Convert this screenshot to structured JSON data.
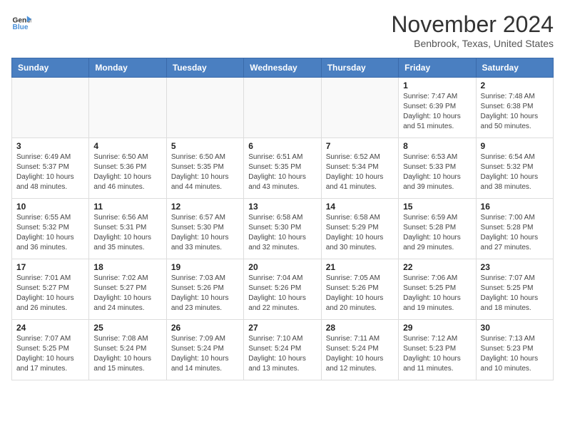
{
  "header": {
    "logo_line1": "General",
    "logo_line2": "Blue",
    "month": "November 2024",
    "location": "Benbrook, Texas, United States"
  },
  "days_of_week": [
    "Sunday",
    "Monday",
    "Tuesday",
    "Wednesday",
    "Thursday",
    "Friday",
    "Saturday"
  ],
  "weeks": [
    [
      {
        "day": "",
        "info": ""
      },
      {
        "day": "",
        "info": ""
      },
      {
        "day": "",
        "info": ""
      },
      {
        "day": "",
        "info": ""
      },
      {
        "day": "",
        "info": ""
      },
      {
        "day": "1",
        "info": "Sunrise: 7:47 AM\nSunset: 6:39 PM\nDaylight: 10 hours and 51 minutes."
      },
      {
        "day": "2",
        "info": "Sunrise: 7:48 AM\nSunset: 6:38 PM\nDaylight: 10 hours and 50 minutes."
      }
    ],
    [
      {
        "day": "3",
        "info": "Sunrise: 6:49 AM\nSunset: 5:37 PM\nDaylight: 10 hours and 48 minutes."
      },
      {
        "day": "4",
        "info": "Sunrise: 6:50 AM\nSunset: 5:36 PM\nDaylight: 10 hours and 46 minutes."
      },
      {
        "day": "5",
        "info": "Sunrise: 6:50 AM\nSunset: 5:35 PM\nDaylight: 10 hours and 44 minutes."
      },
      {
        "day": "6",
        "info": "Sunrise: 6:51 AM\nSunset: 5:35 PM\nDaylight: 10 hours and 43 minutes."
      },
      {
        "day": "7",
        "info": "Sunrise: 6:52 AM\nSunset: 5:34 PM\nDaylight: 10 hours and 41 minutes."
      },
      {
        "day": "8",
        "info": "Sunrise: 6:53 AM\nSunset: 5:33 PM\nDaylight: 10 hours and 39 minutes."
      },
      {
        "day": "9",
        "info": "Sunrise: 6:54 AM\nSunset: 5:32 PM\nDaylight: 10 hours and 38 minutes."
      }
    ],
    [
      {
        "day": "10",
        "info": "Sunrise: 6:55 AM\nSunset: 5:32 PM\nDaylight: 10 hours and 36 minutes."
      },
      {
        "day": "11",
        "info": "Sunrise: 6:56 AM\nSunset: 5:31 PM\nDaylight: 10 hours and 35 minutes."
      },
      {
        "day": "12",
        "info": "Sunrise: 6:57 AM\nSunset: 5:30 PM\nDaylight: 10 hours and 33 minutes."
      },
      {
        "day": "13",
        "info": "Sunrise: 6:58 AM\nSunset: 5:30 PM\nDaylight: 10 hours and 32 minutes."
      },
      {
        "day": "14",
        "info": "Sunrise: 6:58 AM\nSunset: 5:29 PM\nDaylight: 10 hours and 30 minutes."
      },
      {
        "day": "15",
        "info": "Sunrise: 6:59 AM\nSunset: 5:28 PM\nDaylight: 10 hours and 29 minutes."
      },
      {
        "day": "16",
        "info": "Sunrise: 7:00 AM\nSunset: 5:28 PM\nDaylight: 10 hours and 27 minutes."
      }
    ],
    [
      {
        "day": "17",
        "info": "Sunrise: 7:01 AM\nSunset: 5:27 PM\nDaylight: 10 hours and 26 minutes."
      },
      {
        "day": "18",
        "info": "Sunrise: 7:02 AM\nSunset: 5:27 PM\nDaylight: 10 hours and 24 minutes."
      },
      {
        "day": "19",
        "info": "Sunrise: 7:03 AM\nSunset: 5:26 PM\nDaylight: 10 hours and 23 minutes."
      },
      {
        "day": "20",
        "info": "Sunrise: 7:04 AM\nSunset: 5:26 PM\nDaylight: 10 hours and 22 minutes."
      },
      {
        "day": "21",
        "info": "Sunrise: 7:05 AM\nSunset: 5:26 PM\nDaylight: 10 hours and 20 minutes."
      },
      {
        "day": "22",
        "info": "Sunrise: 7:06 AM\nSunset: 5:25 PM\nDaylight: 10 hours and 19 minutes."
      },
      {
        "day": "23",
        "info": "Sunrise: 7:07 AM\nSunset: 5:25 PM\nDaylight: 10 hours and 18 minutes."
      }
    ],
    [
      {
        "day": "24",
        "info": "Sunrise: 7:07 AM\nSunset: 5:25 PM\nDaylight: 10 hours and 17 minutes."
      },
      {
        "day": "25",
        "info": "Sunrise: 7:08 AM\nSunset: 5:24 PM\nDaylight: 10 hours and 15 minutes."
      },
      {
        "day": "26",
        "info": "Sunrise: 7:09 AM\nSunset: 5:24 PM\nDaylight: 10 hours and 14 minutes."
      },
      {
        "day": "27",
        "info": "Sunrise: 7:10 AM\nSunset: 5:24 PM\nDaylight: 10 hours and 13 minutes."
      },
      {
        "day": "28",
        "info": "Sunrise: 7:11 AM\nSunset: 5:24 PM\nDaylight: 10 hours and 12 minutes."
      },
      {
        "day": "29",
        "info": "Sunrise: 7:12 AM\nSunset: 5:23 PM\nDaylight: 10 hours and 11 minutes."
      },
      {
        "day": "30",
        "info": "Sunrise: 7:13 AM\nSunset: 5:23 PM\nDaylight: 10 hours and 10 minutes."
      }
    ]
  ]
}
